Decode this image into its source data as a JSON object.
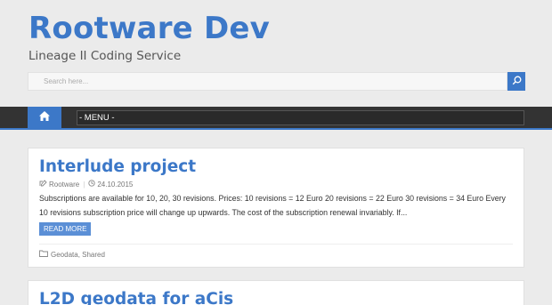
{
  "site": {
    "title": "Rootware Dev",
    "tagline": "Lineage II Coding Service"
  },
  "search": {
    "placeholder": "Search here..."
  },
  "nav": {
    "menu_label": "- MENU -"
  },
  "posts": [
    {
      "title": "Interlude project",
      "author": "Rootware",
      "date": "24.10.2015",
      "excerpt": "Subscriptions are available for 10, 20, 30 revisions. Prices: 10 revisions = 12 Euro 20 revisions = 22 Euro 30 revisions = 34 Euro Every 10 revisions subscription price will change up upwards. The cost of the subscription renewal invariably. If...",
      "read_more": "READ MORE",
      "categories": "Geodata, Shared"
    },
    {
      "title": "L2D geodata for aCis"
    }
  ],
  "colors": {
    "accent": "#3c78c8",
    "navbar": "#333333",
    "background": "#ebebeb"
  },
  "icons": {
    "search": "search-icon",
    "home": "home-icon",
    "author": "author-icon",
    "date": "clock-icon",
    "category": "folder-icon"
  }
}
